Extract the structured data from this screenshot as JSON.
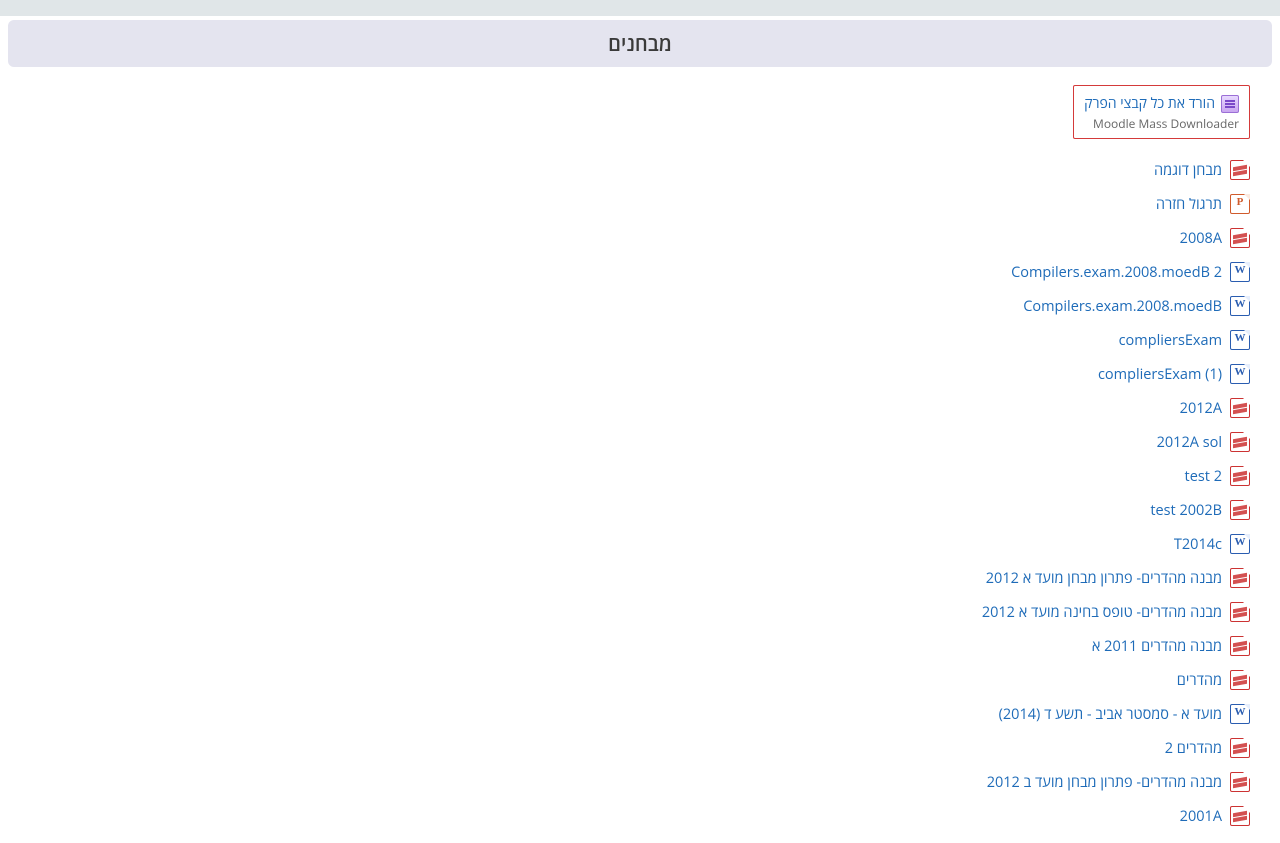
{
  "section": {
    "title": "מבחנים"
  },
  "download_all": {
    "label": "הורד את כל קבצי הפרק",
    "subtitle": "Moodle Mass Downloader"
  },
  "resources": [
    {
      "label": "מבחן דוגמה",
      "type": "pdf"
    },
    {
      "label": "תרגול חזרה",
      "type": "ppt"
    },
    {
      "label": "2008A",
      "type": "pdf"
    },
    {
      "label": "Compilers.exam.2008.moedB 2",
      "type": "doc"
    },
    {
      "label": "Compilers.exam.2008.moedB",
      "type": "doc"
    },
    {
      "label": "compliersExam",
      "type": "doc"
    },
    {
      "label": "compliersExam (1)",
      "type": "doc"
    },
    {
      "label": "2012A",
      "type": "pdf"
    },
    {
      "label": "2012A sol",
      "type": "pdf"
    },
    {
      "label": "test 2",
      "type": "pdf"
    },
    {
      "label": "test 2002B",
      "type": "pdf"
    },
    {
      "label": "T2014c",
      "type": "doc"
    },
    {
      "label": "מבנה מהדרים- פתרון מבחן מועד א 2012",
      "type": "pdf"
    },
    {
      "label": "מבנה מהדרים- טופס בחינה מועד א 2012",
      "type": "pdf"
    },
    {
      "label": "מבנה מהדרים 2011 א",
      "type": "pdf"
    },
    {
      "label": "מהדרים",
      "type": "pdf"
    },
    {
      "label": "מועד א - סמסטר אביב - תשע ד (2014)",
      "type": "doc"
    },
    {
      "label": "מהדרים 2",
      "type": "pdf"
    },
    {
      "label": "מבנה מהדרים- פתרון מבחן מועד ב 2012",
      "type": "pdf"
    },
    {
      "label": "2001A",
      "type": "pdf"
    }
  ]
}
